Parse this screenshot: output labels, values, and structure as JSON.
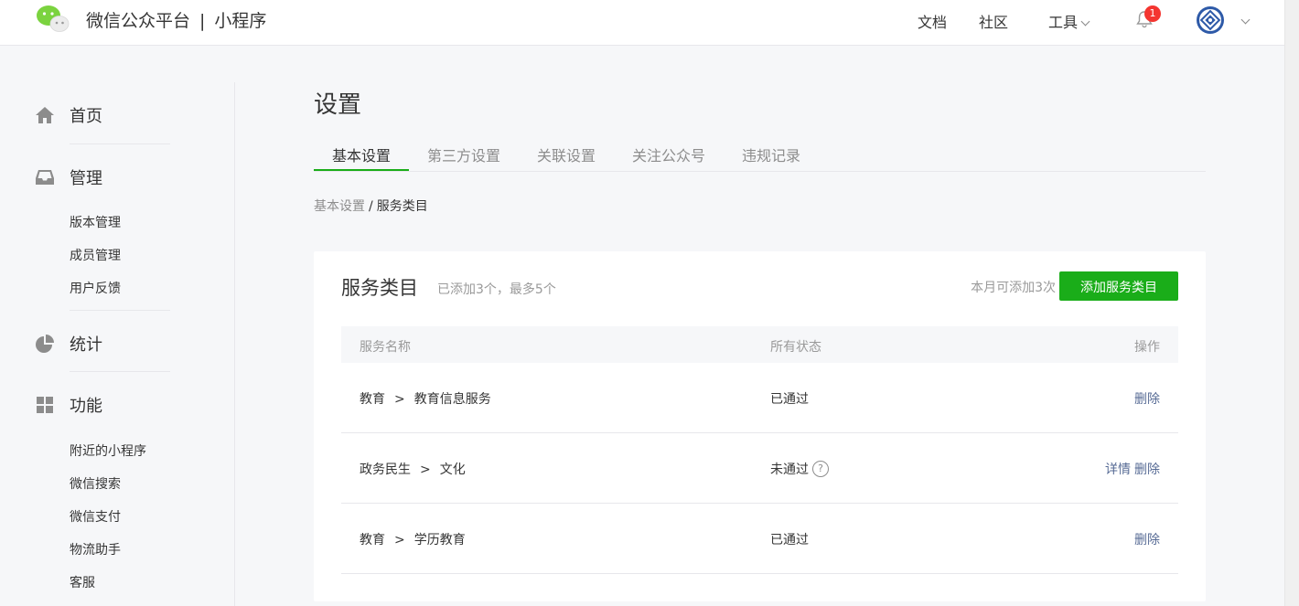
{
  "header": {
    "platform_name": "微信公众平台",
    "separator": "|",
    "product_name": "小程序",
    "nav": {
      "docs": "文档",
      "community": "社区",
      "tools": "工具"
    },
    "notification_count": "1",
    "brand_color": "#1aad19"
  },
  "sidebar": {
    "home": "首页",
    "manage": {
      "label": "管理",
      "items": [
        "版本管理",
        "成员管理",
        "用户反馈"
      ]
    },
    "stats": "统计",
    "features": {
      "label": "功能",
      "items": [
        "附近的小程序",
        "微信搜索",
        "微信支付",
        "物流助手",
        "客服"
      ]
    }
  },
  "main": {
    "title": "设置",
    "tabs": [
      "基本设置",
      "第三方设置",
      "关联设置",
      "关注公众号",
      "违规记录"
    ],
    "active_tab": "基本设置",
    "breadcrumb": {
      "parent": "基本设置",
      "separator": "/",
      "current": "服务类目"
    }
  },
  "card": {
    "title": "服务类目",
    "subtitle": "已添加3个，最多5个",
    "quota": "本月可添加3次",
    "add_button": "添加服务类目",
    "columns": [
      "服务名称",
      "所有状态",
      "操作"
    ],
    "rows": [
      {
        "category": "教育",
        "arrow": ">",
        "subcategory": "教育信息服务",
        "status": "已通过",
        "actions": {
          "delete": "删除"
        }
      },
      {
        "category": "政务民生",
        "arrow": ">",
        "subcategory": "文化",
        "status": "未通过",
        "actions": {
          "details": "详情",
          "delete": "删除"
        }
      },
      {
        "category": "教育",
        "arrow": ">",
        "subcategory": "学历教育",
        "status": "已通过",
        "actions": {
          "delete": "删除"
        }
      }
    ],
    "help_glyph": "?"
  }
}
